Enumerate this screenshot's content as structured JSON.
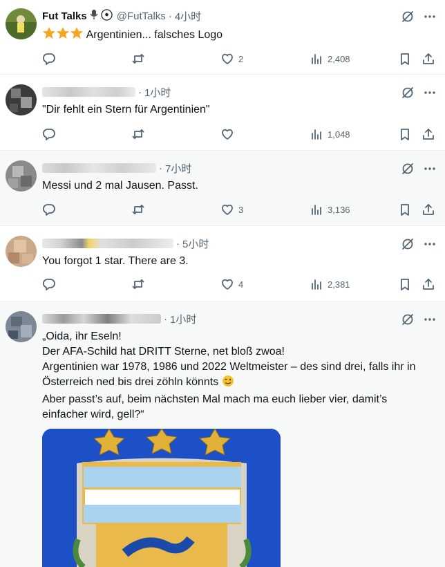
{
  "posts": [
    {
      "name": "Fut Talks",
      "handle": "@FutTalks",
      "time": "4小时",
      "text": "Argentinien... falsches Logo",
      "reply_count": "",
      "retweet_count": "",
      "like_count": "2",
      "view_count": "2,408"
    },
    {
      "time": "1小时",
      "text": "\"Dir fehlt ein Stern für Argentinien\"",
      "like_count": "",
      "view_count": "1,048"
    },
    {
      "time": "7小时",
      "text": "Messi und 2 mal Jausen. Passt.",
      "like_count": "3",
      "view_count": "3,136"
    },
    {
      "time": "5小时",
      "text": "You forgot 1 star. There are 3.",
      "like_count": "4",
      "view_count": "2,381"
    },
    {
      "time": "1小时",
      "lines": [
        "„Oida, ihr Eseln!",
        "Der AFA-Schild hat DRITT Sterne, net bloß zwoa!",
        "Argentinien war 1978, 1986 und 2022 Weltmeister – des sind drei, falls ihr in",
        "Österreich ned bis drei zöhln könnts",
        "Aber passt’s auf, beim nächsten Mal mach ma euch lieber vier, damit’s",
        "einfacher wird, gell?“"
      ]
    }
  ],
  "colors": {
    "text": "#0f1419",
    "secondary": "#536471",
    "star": "#f4a621",
    "media_blue": "#1d50c6"
  }
}
